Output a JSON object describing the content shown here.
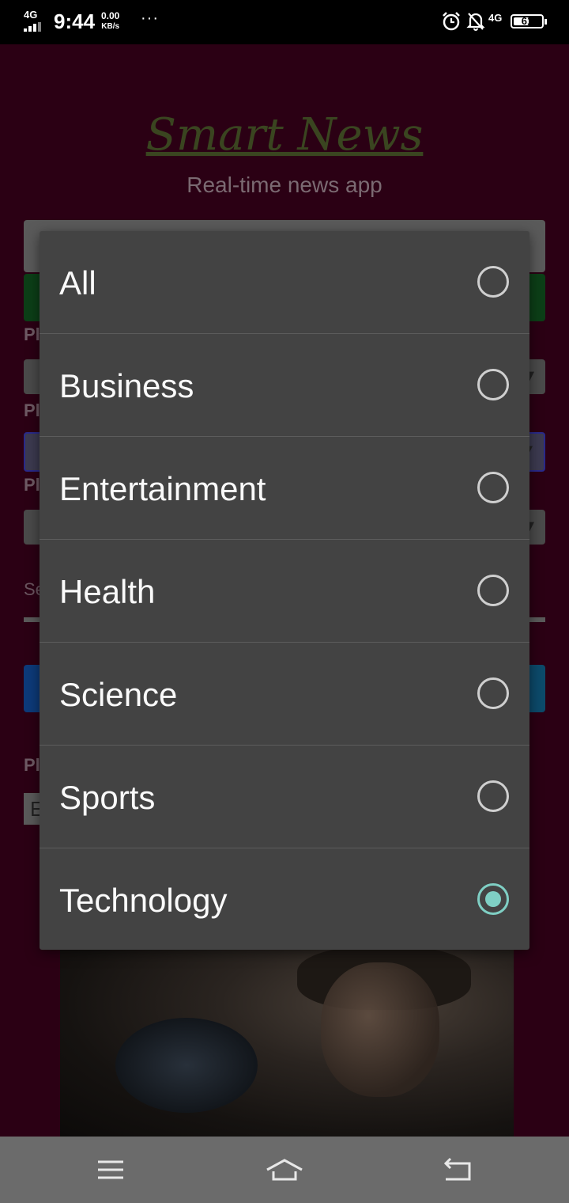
{
  "status_bar": {
    "network_type": "4G",
    "time": "9:44",
    "speed_value": "0.00",
    "speed_unit": "KB/s",
    "more": "···",
    "network_type_right": "4G",
    "battery": "61",
    "battery_level_percent": 61,
    "icons": [
      "signal-icon",
      "alarm-icon",
      "notifications-off-icon",
      "battery-icon"
    ]
  },
  "app": {
    "title": "Smart News",
    "subtitle": "Real-time news app",
    "label_fragments": [
      "Pl",
      "Pl",
      "Pl",
      "Se",
      "Pl",
      "E"
    ],
    "colors": {
      "background": "#2b0014",
      "title": "#3a4520"
    }
  },
  "dialog": {
    "options": [
      {
        "label": "All",
        "selected": false
      },
      {
        "label": "Business",
        "selected": false
      },
      {
        "label": "Entertainment",
        "selected": false
      },
      {
        "label": "Health",
        "selected": false
      },
      {
        "label": "Science",
        "selected": false
      },
      {
        "label": "Sports",
        "selected": false
      },
      {
        "label": "Technology",
        "selected": true
      }
    ],
    "colors": {
      "background": "#434343",
      "accent": "#7fcfc4"
    }
  },
  "nav_bar": {
    "icons": [
      "menu-icon",
      "home-icon",
      "back-icon"
    ]
  }
}
